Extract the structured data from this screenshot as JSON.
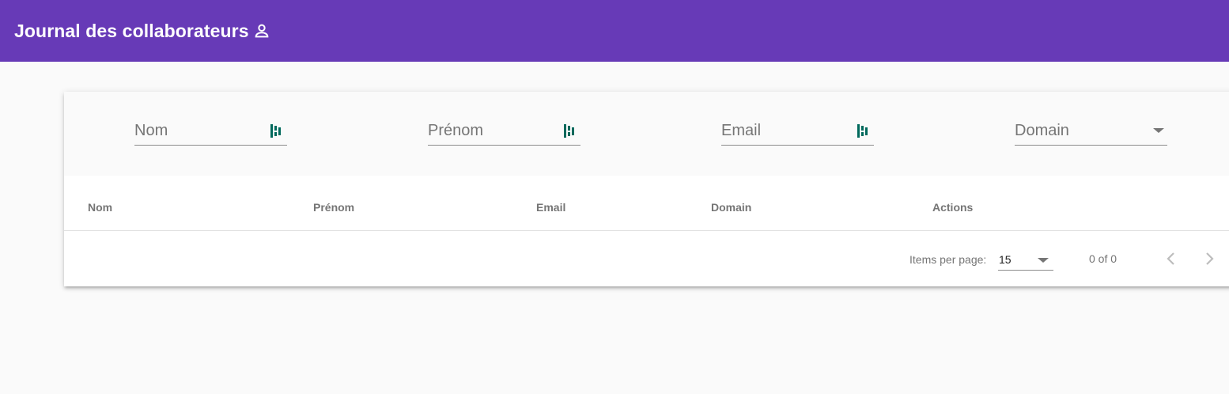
{
  "toolbar": {
    "title": "Journal des collaborateurs",
    "icon": "person-icon",
    "color": "#673ab7"
  },
  "filters": {
    "nom": {
      "placeholder": "Nom",
      "icon": "fingerprint-icon"
    },
    "prenom": {
      "placeholder": "Prénom",
      "icon": "fingerprint-icon"
    },
    "email": {
      "placeholder": "Email",
      "icon": "fingerprint-icon"
    },
    "domain": {
      "placeholder": "Domain",
      "icon": "caret-down-icon"
    }
  },
  "table": {
    "columns": [
      "Nom",
      "Prénom",
      "Email",
      "Domain",
      "Actions"
    ],
    "rows": []
  },
  "paginator": {
    "items_per_page_label": "Items per page:",
    "items_per_page_value": "15",
    "range_label": "0 of 0",
    "prev_icon": "chevron-left-icon",
    "next_icon": "chevron-right-icon"
  },
  "colors": {
    "icon_accent": "#00695c"
  }
}
